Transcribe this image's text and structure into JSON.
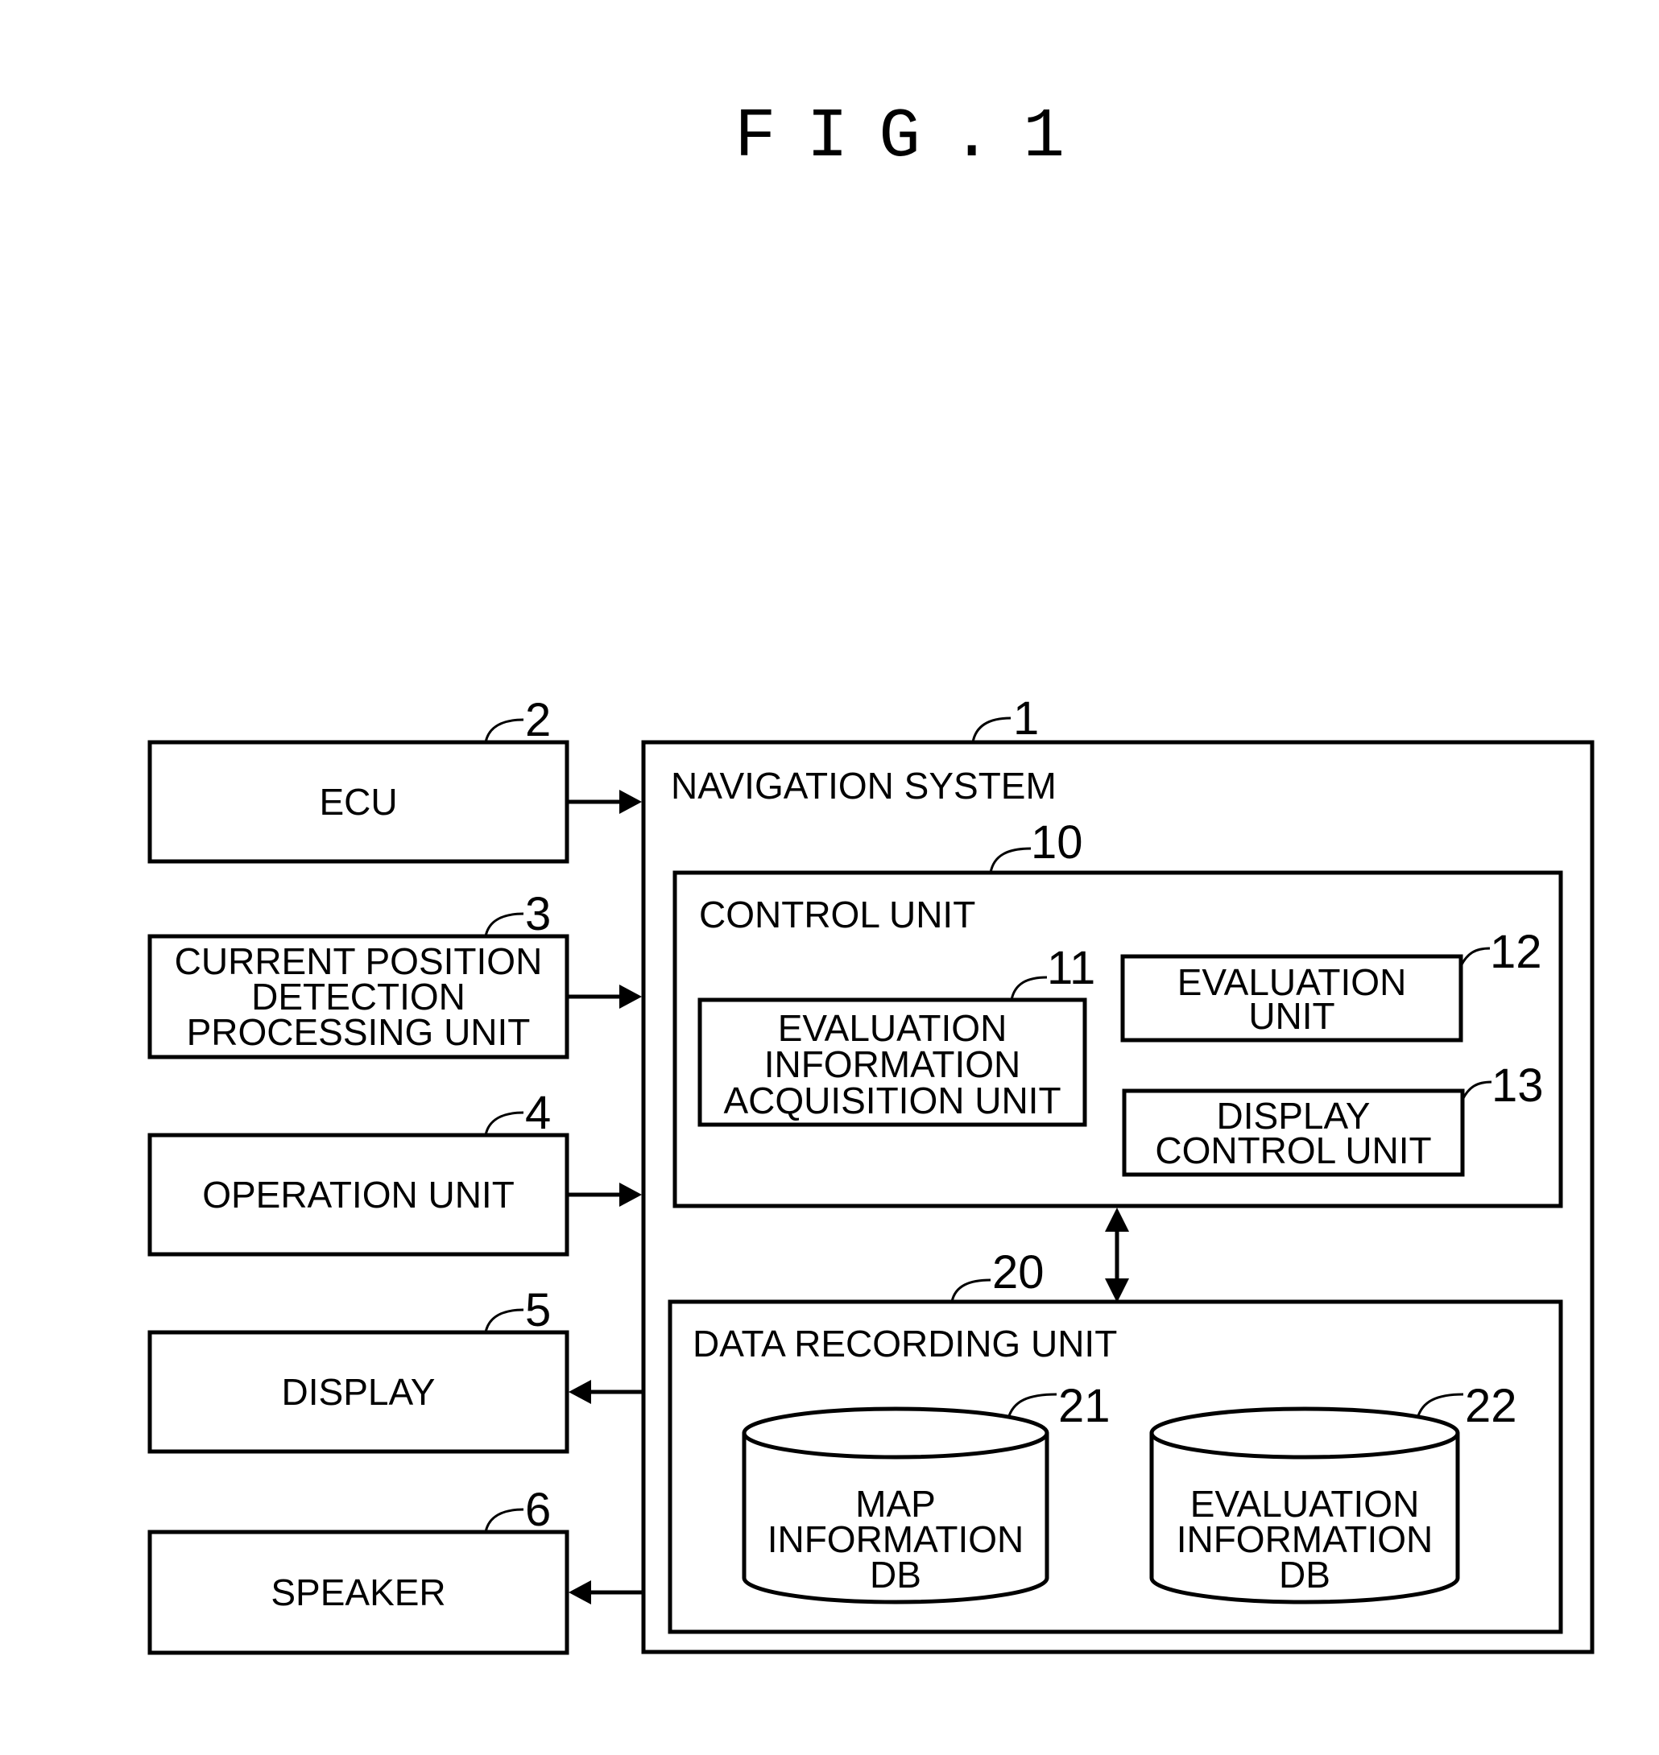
{
  "figure_title": "FIG.1",
  "external_units": [
    {
      "ref": "2",
      "lines": [
        "ECU"
      ],
      "direction": "in"
    },
    {
      "ref": "3",
      "lines": [
        "CURRENT POSITION",
        "DETECTION",
        "PROCESSING UNIT"
      ],
      "direction": "in"
    },
    {
      "ref": "4",
      "lines": [
        "OPERATION UNIT"
      ],
      "direction": "in"
    },
    {
      "ref": "5",
      "lines": [
        "DISPLAY"
      ],
      "direction": "out"
    },
    {
      "ref": "6",
      "lines": [
        "SPEAKER"
      ],
      "direction": "out"
    }
  ],
  "navigation_system": {
    "ref": "1",
    "label": "NAVIGATION SYSTEM",
    "control_unit": {
      "ref": "10",
      "label": "CONTROL UNIT",
      "sub_units": [
        {
          "ref": "11",
          "lines": [
            "EVALUATION",
            "INFORMATION",
            "ACQUISITION UNIT"
          ]
        },
        {
          "ref": "12",
          "lines": [
            "EVALUATION",
            "UNIT"
          ]
        },
        {
          "ref": "13",
          "lines": [
            "DISPLAY",
            "CONTROL UNIT"
          ]
        }
      ]
    },
    "link": "bidirectional",
    "data_recording_unit": {
      "ref": "20",
      "label": "DATA RECORDING UNIT",
      "databases": [
        {
          "ref": "21",
          "lines": [
            "MAP",
            "INFORMATION",
            "DB"
          ]
        },
        {
          "ref": "22",
          "lines": [
            "EVALUATION",
            "INFORMATION",
            "DB"
          ]
        }
      ]
    }
  }
}
